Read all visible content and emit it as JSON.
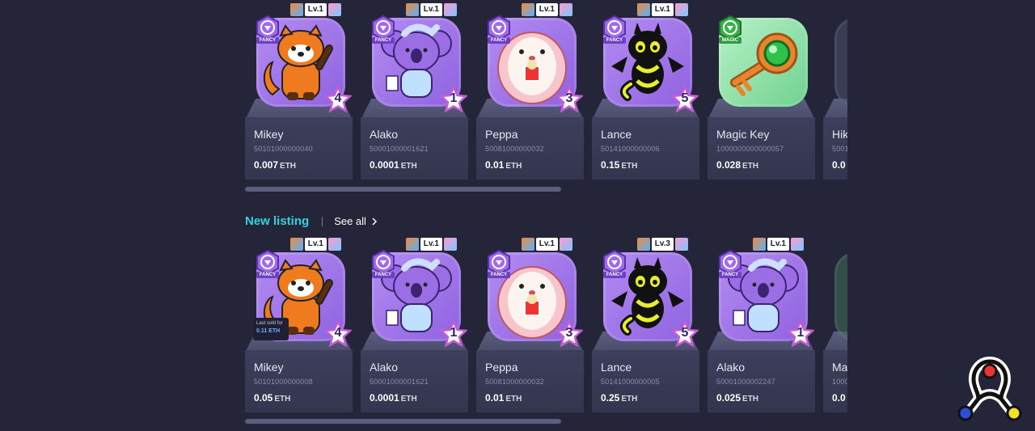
{
  "rows": [
    {
      "cards": [
        {
          "name": "Mikey",
          "id": "50101000000040",
          "price": "0.007",
          "unit": "ETH",
          "level": "Lv.1",
          "rarity": "FANCY",
          "stars": "4",
          "character": "red-panda",
          "tile": "purple"
        },
        {
          "name": "Alako",
          "id": "50001000001621",
          "price": "0.0001",
          "unit": "ETH",
          "level": "Lv.1",
          "rarity": "FANCY",
          "stars": "1",
          "character": "koala",
          "tile": "purple"
        },
        {
          "name": "Peppa",
          "id": "50081000000032",
          "price": "0.01",
          "unit": "ETH",
          "level": "Lv.1",
          "rarity": "FANCY",
          "stars": "3",
          "character": "hedgehog",
          "tile": "purple"
        },
        {
          "name": "Lance",
          "id": "50141000000006",
          "price": "0.15",
          "unit": "ETH",
          "level": "Lv.1",
          "rarity": "FANCY",
          "stars": "5",
          "character": "dragon",
          "tile": "purple"
        },
        {
          "name": "Magic Key",
          "id": "1000000000000057",
          "price": "0.028",
          "unit": "ETH",
          "level": "",
          "rarity": "MAGIC",
          "stars": "",
          "character": "key",
          "tile": "green"
        },
        {
          "name": "Hik",
          "id": "5001",
          "price": "0.0",
          "unit": "",
          "level": "",
          "rarity": "",
          "stars": "",
          "character": "partial",
          "tile": "dim"
        }
      ]
    },
    {
      "cards": [
        {
          "name": "Mikey",
          "id": "50101000000008",
          "price": "0.05",
          "unit": "ETH",
          "level": "Lv.1",
          "rarity": "FANCY",
          "stars": "4",
          "character": "red-panda",
          "tile": "purple",
          "last_sold_label": "Last sold for",
          "last_sold_value": "0.11 ETH"
        },
        {
          "name": "Alako",
          "id": "50001000001621",
          "price": "0.0001",
          "unit": "ETH",
          "level": "Lv.1",
          "rarity": "FANCY",
          "stars": "1",
          "character": "koala",
          "tile": "purple"
        },
        {
          "name": "Peppa",
          "id": "50081000000032",
          "price": "0.01",
          "unit": "ETH",
          "level": "Lv.1",
          "rarity": "FANCY",
          "stars": "3",
          "character": "hedgehog",
          "tile": "purple"
        },
        {
          "name": "Lance",
          "id": "50141000000005",
          "price": "0.25",
          "unit": "ETH",
          "level": "Lv.3",
          "rarity": "FANCY",
          "stars": "5",
          "character": "dragon",
          "tile": "purple"
        },
        {
          "name": "Alako",
          "id": "50001000002247",
          "price": "0.025",
          "unit": "ETH",
          "level": "Lv.1",
          "rarity": "FANCY",
          "stars": "1",
          "character": "koala",
          "tile": "purple"
        },
        {
          "name": "Ma",
          "id": "1000",
          "price": "0.0",
          "unit": "",
          "level": "",
          "rarity": "",
          "stars": "",
          "character": "partial",
          "tile": "dim-green"
        }
      ]
    }
  ],
  "section": {
    "title": "New listing",
    "see_all": "See all",
    "chevron": "chevron-right-icon"
  },
  "colors": {
    "background": "#242538",
    "accent": "#35d1e0",
    "tile_purple": "#a57be9",
    "tile_green": "#8fe0a8"
  }
}
